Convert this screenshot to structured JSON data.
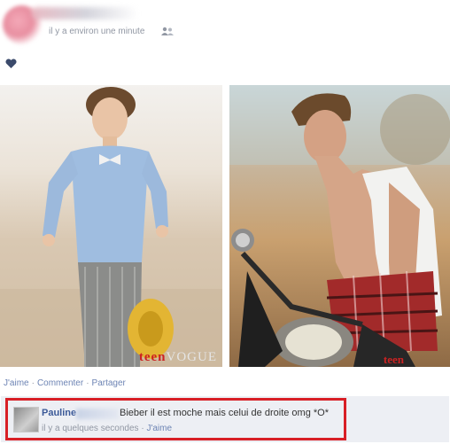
{
  "post": {
    "timestamp": "il y a environ une minute"
  },
  "photos": {
    "left_watermark": "teen",
    "left_watermark_suffix": "VOGUE",
    "right_watermark": "teen"
  },
  "actions": {
    "like": "J'aime",
    "comment": "Commenter",
    "share": "Partager",
    "separator": "·"
  },
  "comment": {
    "author_first_name": "Pauline",
    "text": "Bieber il est moche mais celui de droite omg *O*",
    "time": "il y a quelques secondes",
    "separator": "·",
    "like": "J'aime"
  },
  "colors": {
    "link": "#3b5998",
    "muted": "#9197a3",
    "highlight_border": "#d81f26",
    "comment_bg": "#edeff4"
  },
  "icons": {
    "privacy": "friends-icon",
    "reaction": "heart-icon"
  }
}
